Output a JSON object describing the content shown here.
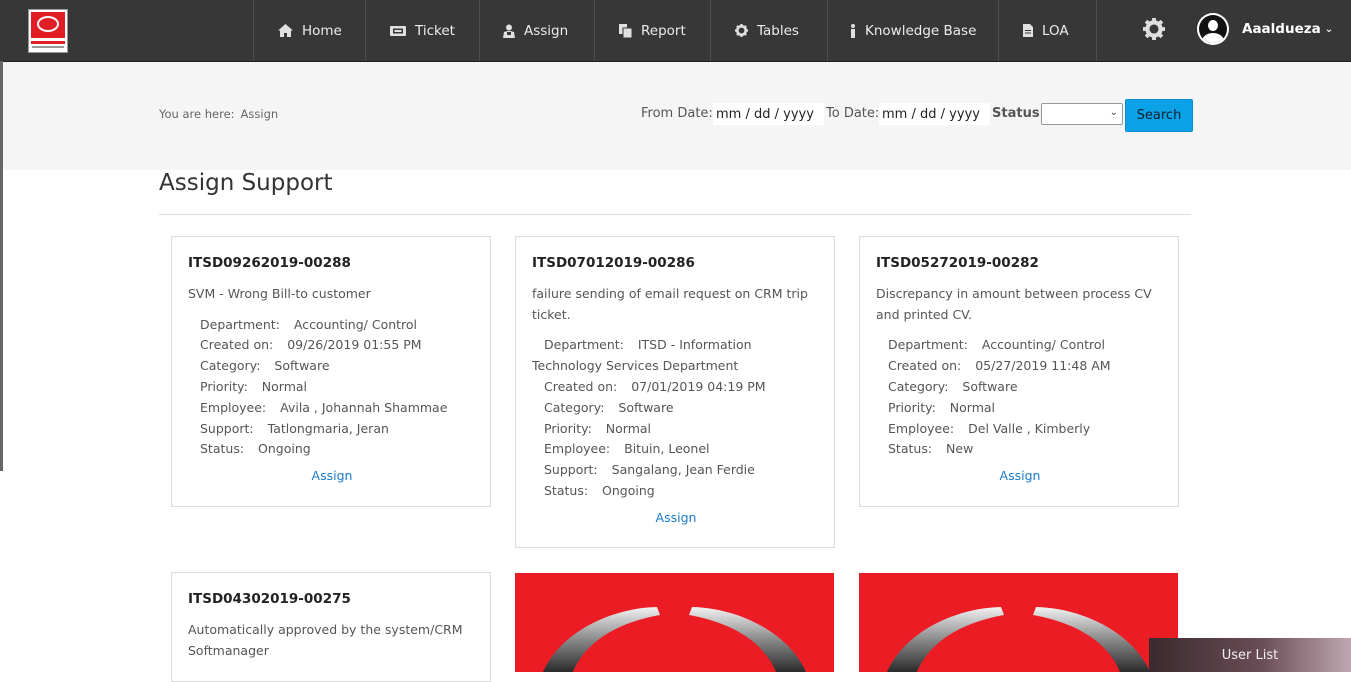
{
  "nav": {
    "items": [
      {
        "label": "Home",
        "icon": "home-icon"
      },
      {
        "label": "Ticket",
        "icon": "ticket-icon"
      },
      {
        "label": "Assign",
        "icon": "assign-icon"
      },
      {
        "label": "Report",
        "icon": "report-icon"
      },
      {
        "label": "Tables",
        "icon": "gear-icon"
      },
      {
        "label": "Knowledge Base",
        "icon": "info-icon"
      },
      {
        "label": "LOA",
        "icon": "document-icon"
      }
    ],
    "username": "Aaaldueza"
  },
  "breadcrumb": {
    "prefix": "You are here:",
    "current": "Assign"
  },
  "filters": {
    "from_label": "From Date:",
    "from_value": "mm / dd / yyyy",
    "to_label": "To Date:",
    "to_value": "mm / dd / yyyy",
    "status_label": "Status:",
    "status_value": "",
    "search_label": "Search"
  },
  "page": {
    "title": "Assign Support"
  },
  "labels": {
    "department": "Department:",
    "created": "Created on:",
    "category": "Category:",
    "priority": "Priority:",
    "employee": "Employee:",
    "support": "Support:",
    "status": "Status:",
    "assign": "Assign"
  },
  "tickets": [
    {
      "id": "ITSD09262019-00288",
      "description": "SVM - Wrong Bill-to customer",
      "department": "Accounting/ Control",
      "created": "09/26/2019 01:55 PM",
      "category": "Software",
      "priority": "Normal",
      "employee": "Avila , Johannah Shammae",
      "support": "Tatlongmaria, Jeran",
      "status": "Ongoing"
    },
    {
      "id": "ITSD07012019-00286",
      "description": "failure sending of email request on CRM trip ticket.",
      "department": "ITSD - Information",
      "department_cont": "Technology Services Department",
      "created": "07/01/2019 04:19 PM",
      "category": "Software",
      "priority": "Normal",
      "employee": "Bituin, Leonel",
      "support": "Sangalang, Jean Ferdie",
      "status": "Ongoing"
    },
    {
      "id": "ITSD05272019-00282",
      "description": "Discrepancy in amount between process CV and printed CV.",
      "department": "Accounting/ Control",
      "created": "05/27/2019 11:48 AM",
      "category": "Software",
      "priority": "Normal",
      "employee": "Del Valle , Kimberly",
      "status": "New"
    },
    {
      "id": "ITSD04302019-00275",
      "description": "Automatically approved by the system/CRM Softmanager"
    }
  ],
  "footer": {
    "user_list": "User List"
  },
  "colors": {
    "navbar": "#373737",
    "accent": "#0aa1e6",
    "brand_red": "#ec1c24",
    "link": "#1a7bc9"
  }
}
